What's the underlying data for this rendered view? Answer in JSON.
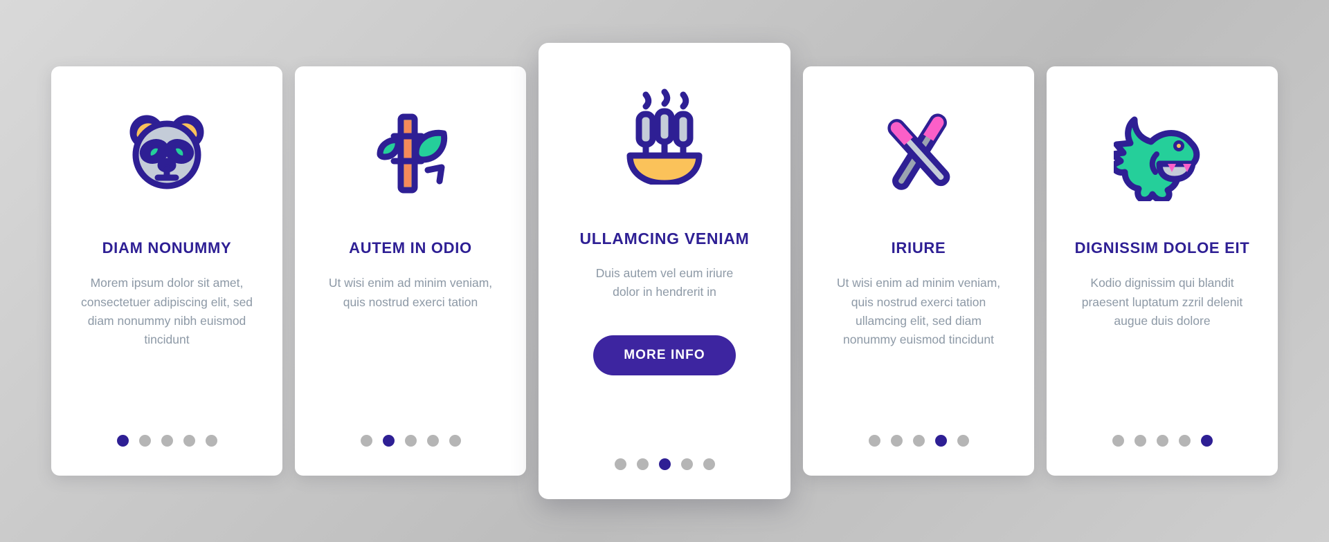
{
  "theme": {
    "background": "#cccccc",
    "card_background": "#ffffff",
    "title_color": "#2e1f94",
    "body_color": "#8d99a6",
    "accent": "#3d25a0",
    "dot_inactive": "#b5b5b5",
    "dot_active": "#2e1f94",
    "icon_outline": "#2e1f94",
    "icon_green": "#25cf9a",
    "icon_yellow": "#fbc25a",
    "icon_grey_blue": "#c4ccd8",
    "icon_orange": "#f58a5a",
    "icon_pink": "#fb5fc8"
  },
  "cards": [
    {
      "id": "card-1",
      "icon": "panda-head-icon",
      "title": "DIAM NONUMMY",
      "body": "Morem ipsum dolor sit amet, consectetuer adipiscing elit, sed diam nonummy nibh euismod tincidunt",
      "button": null,
      "dots": {
        "count": 5,
        "active_index": 0
      }
    },
    {
      "id": "card-2",
      "icon": "bamboo-icon",
      "title": "AUTEM IN ODIO",
      "body": "Ut wisi enim ad minim veniam, quis nostrud exerci tation",
      "button": null,
      "dots": {
        "count": 5,
        "active_index": 1
      }
    },
    {
      "id": "card-3",
      "icon": "incense-bowl-icon",
      "title": "ULLAMCING VENIAM",
      "body": "Duis autem vel eum iriure dolor in hendrerit in",
      "button": "MORE INFO",
      "dots": {
        "count": 5,
        "active_index": 2
      }
    },
    {
      "id": "card-4",
      "icon": "chopsticks-icon",
      "title": "IRIURE",
      "body": "Ut wisi enim ad minim veniam, quis nostrud exerci tation ullamcing elit, sed diam nonummy euismod tincidunt",
      "button": null,
      "dots": {
        "count": 5,
        "active_index": 3
      }
    },
    {
      "id": "card-5",
      "icon": "dragon-head-icon",
      "title": "DIGNISSIM DOLOE EIT",
      "body": "Kodio dignissim qui blandit praesent luptatum zzril delenit augue duis dolore",
      "button": null,
      "dots": {
        "count": 5,
        "active_index": 4
      }
    }
  ]
}
